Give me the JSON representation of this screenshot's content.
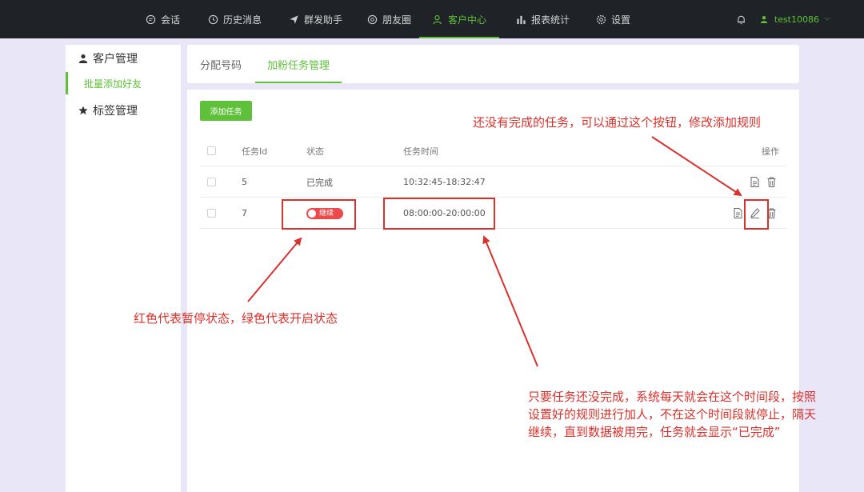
{
  "nav": {
    "items": [
      {
        "label": "会话",
        "icon": "chat-icon"
      },
      {
        "label": "历史消息",
        "icon": "clock-icon"
      },
      {
        "label": "群发助手",
        "icon": "send-icon"
      },
      {
        "label": "朋友圈",
        "icon": "camera-icon"
      },
      {
        "label": "客户中心",
        "icon": "user-icon",
        "active": true
      },
      {
        "label": "报表统计",
        "icon": "bar-chart-icon"
      },
      {
        "label": "设置",
        "icon": "gear-icon"
      }
    ],
    "user": "test10086",
    "accent": "#5fc13a"
  },
  "sidebar": {
    "customer_group": "客户管理",
    "batch_add": "批量添加好友",
    "tag_group": "标签管理"
  },
  "tabs": [
    "分配号码",
    "加粉任务管理"
  ],
  "main": {
    "add_button": "添加任务",
    "columns": {
      "id": "任务Id",
      "status": "状态",
      "time": "任务时间",
      "ops": "操作"
    },
    "rows": [
      {
        "id": "5",
        "status": "已完成",
        "time": "10:32:45-18:32:47"
      },
      {
        "id": "7",
        "status_switch": "继续",
        "time": "08:00:00-20:00:00"
      }
    ]
  },
  "annotations": {
    "edit_note": "还没有完成的任务，可以通过这个按钮，修改添加规则",
    "status_note": "红色代表暂停状态，绿色代表开启状态",
    "time_note_l1": "只要任务还没完成，系统每天就会在这个时间段，按照",
    "time_note_l2": "设置好的规则进行加人，不在这个时间段就停止，隔天",
    "time_note_l3": "继续，直到数据被用完，任务就会显示“已完成”",
    "color": "#d9312b"
  }
}
